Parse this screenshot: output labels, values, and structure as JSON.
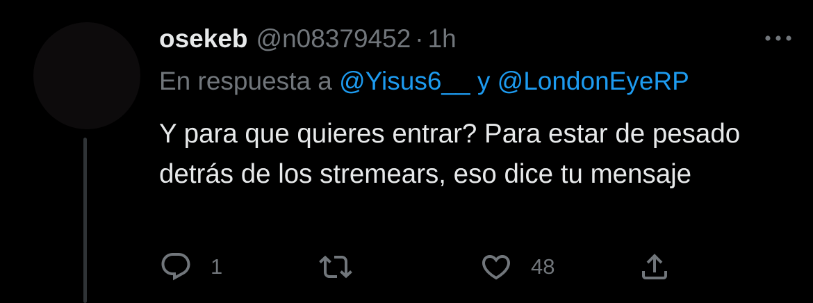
{
  "tweet": {
    "author": {
      "display_name": "osekeb",
      "handle": "@n08379452",
      "separator": "·",
      "time": "1h"
    },
    "reply_to": {
      "prefix": "En respuesta a",
      "mention_1": "@Yisus6__",
      "joiner": "y",
      "mention_2": "@LondonEyeRP"
    },
    "text": "Y para que quieres entrar? Para estar de pesado detrás de los stremears, eso dice tu mensaje",
    "actions": {
      "reply_count": "1",
      "retweet_count": "",
      "like_count": "48"
    },
    "icons": [
      "more-icon",
      "reply-icon",
      "retweet-icon",
      "like-icon",
      "share-icon"
    ]
  },
  "colors": {
    "background": "#000000",
    "primary_text": "#e7e9ea",
    "secondary_text": "#71767b",
    "link": "#1d9bf0",
    "thread_line": "#2f3336"
  }
}
